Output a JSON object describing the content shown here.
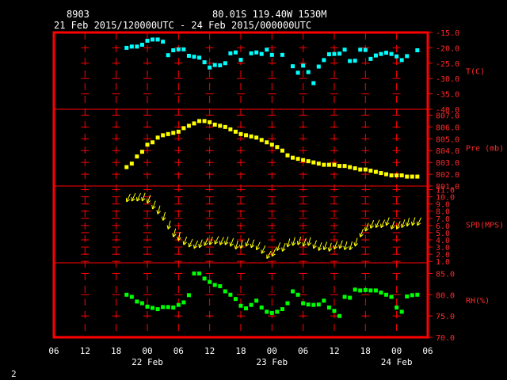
{
  "header": {
    "station_id": "8903",
    "location": "80.01S  119.40W  1530M",
    "time_range": "21 Feb 2015/120000UTC - 24 Feb 2015/000000UTC"
  },
  "footer_page": "2",
  "colors": {
    "frame": "#ff0000",
    "grid": "#ff0000",
    "temperature": "#00ffff",
    "pressure": "#ffff00",
    "wind": "#ffff00",
    "humidity": "#00ff00",
    "background": "#000000"
  },
  "x_axis": {
    "tick_labels": [
      "06",
      "12",
      "18",
      "00",
      "06",
      "12",
      "18",
      "00",
      "06",
      "12",
      "18",
      "00",
      "06"
    ],
    "day_labels": [
      "22 Feb",
      "23 Feb",
      "24 Feb"
    ]
  },
  "chart_data": [
    {
      "type": "scatter",
      "label": "T(C)",
      "ylim": [
        -40,
        -15
      ],
      "yticks": [
        "-15.0",
        "-20.0",
        "-25.0",
        "-30.0",
        "-35.0",
        "-40.0"
      ],
      "x": [
        14,
        15,
        16,
        17,
        18,
        19,
        20,
        21,
        22,
        23,
        24,
        25,
        26,
        27,
        28,
        29,
        30,
        31,
        32,
        33,
        34,
        35,
        36,
        38,
        39,
        40,
        41,
        42,
        44,
        46,
        47,
        48,
        49,
        50,
        51,
        52,
        53,
        54,
        55,
        56,
        57,
        58,
        59,
        60,
        61,
        62,
        63,
        64,
        65,
        66,
        67,
        68,
        70
      ],
      "y": [
        -20.0,
        -19.6,
        -19.6,
        -19.0,
        -17.7,
        -17.3,
        -17.3,
        -18.0,
        -22.4,
        -20.8,
        -20.5,
        -20.5,
        -22.6,
        -22.9,
        -23.2,
        -24.7,
        -26.4,
        -25.6,
        -25.7,
        -25.0,
        -21.8,
        -21.5,
        -23.9,
        -21.8,
        -21.5,
        -22.0,
        -20.6,
        -22.3,
        -22.3,
        -26.0,
        -28.1,
        -25.8,
        -27.9,
        -31.5,
        -26.1,
        -24.0,
        -22.1,
        -22.0,
        -21.9,
        -20.6,
        -24.3,
        -24.2,
        -20.6,
        -20.7,
        -23.6,
        -22.5,
        -22.0,
        -21.6,
        -22.0,
        -22.8,
        -24.0,
        -22.7,
        -20.8
      ]
    },
    {
      "type": "scatter",
      "label": "Pre (mb)",
      "ylim": [
        801,
        807
      ],
      "yticks": [
        "807.0",
        "806.0",
        "805.0",
        "804.0",
        "803.0",
        "802.0",
        "801.0"
      ],
      "x": [
        14,
        15,
        16,
        17,
        18,
        19,
        20,
        21,
        22,
        23,
        24,
        25,
        26,
        27,
        28,
        29,
        30,
        31,
        32,
        33,
        34,
        35,
        36,
        37,
        38,
        39,
        40,
        41,
        42,
        43,
        44,
        45,
        46,
        47,
        48,
        49,
        50,
        51,
        52,
        53,
        54,
        55,
        56,
        57,
        58,
        59,
        60,
        61,
        62,
        63,
        64,
        65,
        66,
        67,
        68,
        69,
        70
      ],
      "y": [
        802.6,
        802.9,
        803.5,
        803.9,
        804.5,
        804.7,
        805.1,
        805.3,
        805.4,
        805.5,
        805.6,
        805.9,
        806.1,
        806.3,
        806.5,
        806.5,
        806.4,
        806.2,
        806.1,
        806.0,
        805.8,
        805.6,
        805.4,
        805.3,
        805.2,
        805.1,
        804.9,
        804.7,
        804.5,
        804.3,
        804.0,
        803.6,
        803.4,
        803.3,
        803.2,
        803.1,
        803.0,
        802.9,
        802.8,
        802.8,
        802.8,
        802.7,
        802.7,
        802.6,
        802.5,
        802.4,
        802.4,
        802.3,
        802.2,
        802.1,
        802.0,
        801.9,
        801.9,
        801.9,
        801.8,
        801.8,
        801.8
      ]
    },
    {
      "type": "scatter",
      "label": "SPD(MPS)",
      "ylim": [
        1,
        11
      ],
      "yticks": [
        "11.0",
        "10.0",
        "9.0",
        "8.0",
        "7.0",
        "6.0",
        "5.0",
        "4.0",
        "3.0",
        "2.0",
        "1.0"
      ],
      "x": [
        14,
        15,
        16,
        17,
        18,
        19,
        20,
        21,
        22,
        23,
        24,
        25,
        26,
        27,
        28,
        29,
        30,
        31,
        32,
        33,
        34,
        35,
        36,
        37,
        38,
        39,
        40,
        41,
        42,
        43,
        44,
        45,
        46,
        47,
        48,
        49,
        50,
        51,
        52,
        53,
        54,
        55,
        56,
        57,
        58,
        59,
        60,
        61,
        62,
        63,
        64,
        65,
        66,
        67,
        68,
        69,
        70
      ],
      "y": [
        9.3,
        9.4,
        9.4,
        9.4,
        9.1,
        8.3,
        7.6,
        6.7,
        5.5,
        4.4,
        3.9,
        3.3,
        3.0,
        2.8,
        2.9,
        3.2,
        3.3,
        3.4,
        3.3,
        3.3,
        3.1,
        2.7,
        2.8,
        3.1,
        2.9,
        2.6,
        2.1,
        1.4,
        1.7,
        2.5,
        2.4,
        3.0,
        3.2,
        3.3,
        3.1,
        3.2,
        2.8,
        2.5,
        2.6,
        2.4,
        2.7,
        2.8,
        2.6,
        2.6,
        3.1,
        4.4,
        5.2,
        5.6,
        5.7,
        5.7,
        6.0,
        5.5,
        5.5,
        5.7,
        5.9,
        6.0,
        6.0
      ],
      "direction_deg": [
        25,
        25,
        25,
        20,
        20,
        20,
        15,
        15,
        15,
        15,
        10,
        20,
        25,
        25,
        20,
        25,
        20,
        25,
        25,
        20,
        20,
        15,
        10,
        20,
        20,
        25,
        25,
        30,
        25,
        20,
        20,
        15,
        15,
        20,
        20,
        15,
        20,
        20,
        20,
        15,
        20,
        20,
        15,
        15,
        15,
        20,
        20,
        20,
        25,
        25,
        20,
        20,
        25,
        20,
        15,
        20,
        25
      ]
    },
    {
      "type": "scatter",
      "label": "RH(%)",
      "ylim": [
        70,
        87
      ],
      "yticks": [
        "85.0",
        "80.0",
        "75.0",
        "70.0"
      ],
      "x": [
        14,
        15,
        16,
        17,
        18,
        19,
        20,
        21,
        22,
        23,
        24,
        25,
        26,
        27,
        28,
        29,
        30,
        31,
        32,
        33,
        34,
        35,
        36,
        37,
        38,
        39,
        40,
        41,
        42,
        43,
        44,
        45,
        46,
        47,
        48,
        49,
        50,
        51,
        52,
        53,
        54,
        55,
        56,
        57,
        58,
        59,
        60,
        61,
        62,
        63,
        64,
        65,
        66,
        67,
        68,
        69,
        70
      ],
      "y": [
        80.0,
        79.5,
        78.4,
        78.0,
        77.2,
        76.9,
        76.6,
        77.1,
        77.1,
        77.0,
        77.6,
        78.2,
        79.9,
        85.0,
        85.0,
        83.8,
        83.0,
        82.3,
        82.0,
        80.8,
        80.0,
        79.0,
        77.4,
        76.8,
        77.6,
        78.6,
        77.0,
        76.0,
        75.7,
        76.0,
        76.6,
        78.0,
        80.8,
        80.0,
        78.0,
        77.7,
        77.6,
        77.7,
        78.6,
        77.0,
        76.2,
        75.0,
        79.5,
        79.3,
        81.2,
        81.0,
        81.1,
        81.0,
        81.0,
        80.5,
        80.0,
        79.5,
        77.0,
        76.0,
        79.6,
        79.9,
        80.0
      ]
    }
  ]
}
